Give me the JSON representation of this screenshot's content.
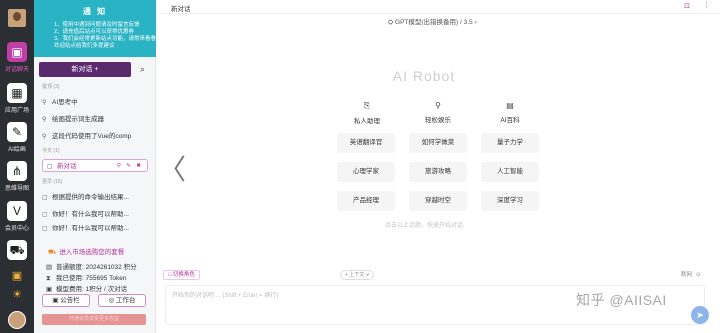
{
  "rail": {
    "items": [
      {
        "label": "对话聊天",
        "icon": "chat-icon"
      },
      {
        "label": "应用广场",
        "icon": "apps-icon"
      },
      {
        "label": "AI绘画",
        "icon": "paint-icon"
      },
      {
        "label": "思维导图",
        "icon": "mindmap-icon"
      },
      {
        "label": "会员中心",
        "icon": "vip-icon"
      },
      {
        "label": "",
        "icon": "cart-icon"
      },
      {
        "label": "",
        "icon": "gift-icon"
      }
    ]
  },
  "sidebar": {
    "notice": {
      "title": "通 知",
      "lines": [
        "1、使用中遇到问题请及时留言反馈",
        "2、请充值后站点可以获得优惠券",
        "3、我们会经常更新站点功能，请常来看看",
        "欢迎站点给我们多提建议"
      ]
    },
    "new_chat_label": "新对话 +",
    "sections": {
      "featured": "置顶",
      "today": "今天",
      "earlier": "更早"
    },
    "section_counts": {
      "featured": "(3)",
      "today": "(1)",
      "earlier": "(15)"
    },
    "featured_items": [
      "AI思考中",
      "绘画提示词生成器",
      "这段代码使用了Vue的comp"
    ],
    "today_items": [
      "新对话"
    ],
    "earlier_items": [
      "根据提供的命令输出结果...",
      "你好！有什么我可以帮助...",
      "你好！有什么我可以帮助..."
    ],
    "market_link": "进入市场选购您的套餐",
    "stats": [
      {
        "label": "普通额度:",
        "value": "2024261032 积分"
      },
      {
        "label": "我已使用:",
        "value": "755695 Token"
      },
      {
        "label": "模型费用:",
        "value": "1积分 / 次对话"
      }
    ],
    "announcement_btn": "公告栏",
    "workbench_btn": "工作台",
    "bottom_bar": "开通会员享受更多权益"
  },
  "topbar": {
    "title": "新对话"
  },
  "model_selector": "GPT模型(出错换备用) / 3.5",
  "brand": "AI Robot",
  "categories": [
    {
      "label": "私人助理",
      "icon": "assistant-icon"
    },
    {
      "label": "轻松娱乐",
      "icon": "pin-icon"
    },
    {
      "label": "AI百科",
      "icon": "book-icon"
    }
  ],
  "chips": [
    [
      "英语翻译官",
      "如何学做菜",
      "量子力学"
    ],
    [
      "心理学家",
      "旅游攻略",
      "人工智能"
    ],
    [
      "产品经理",
      "穿越时空",
      "深度学习"
    ]
  ],
  "hint": "点击以上话题，快速开始对话",
  "input": {
    "role_label": "□ 切换角色",
    "context_label": "+ 上下文 ∨",
    "online_label": "联网",
    "placeholder": "开始你的对话吧 ... (Shift + Enter = 换行)"
  },
  "watermark": "知乎 @AIISAI"
}
